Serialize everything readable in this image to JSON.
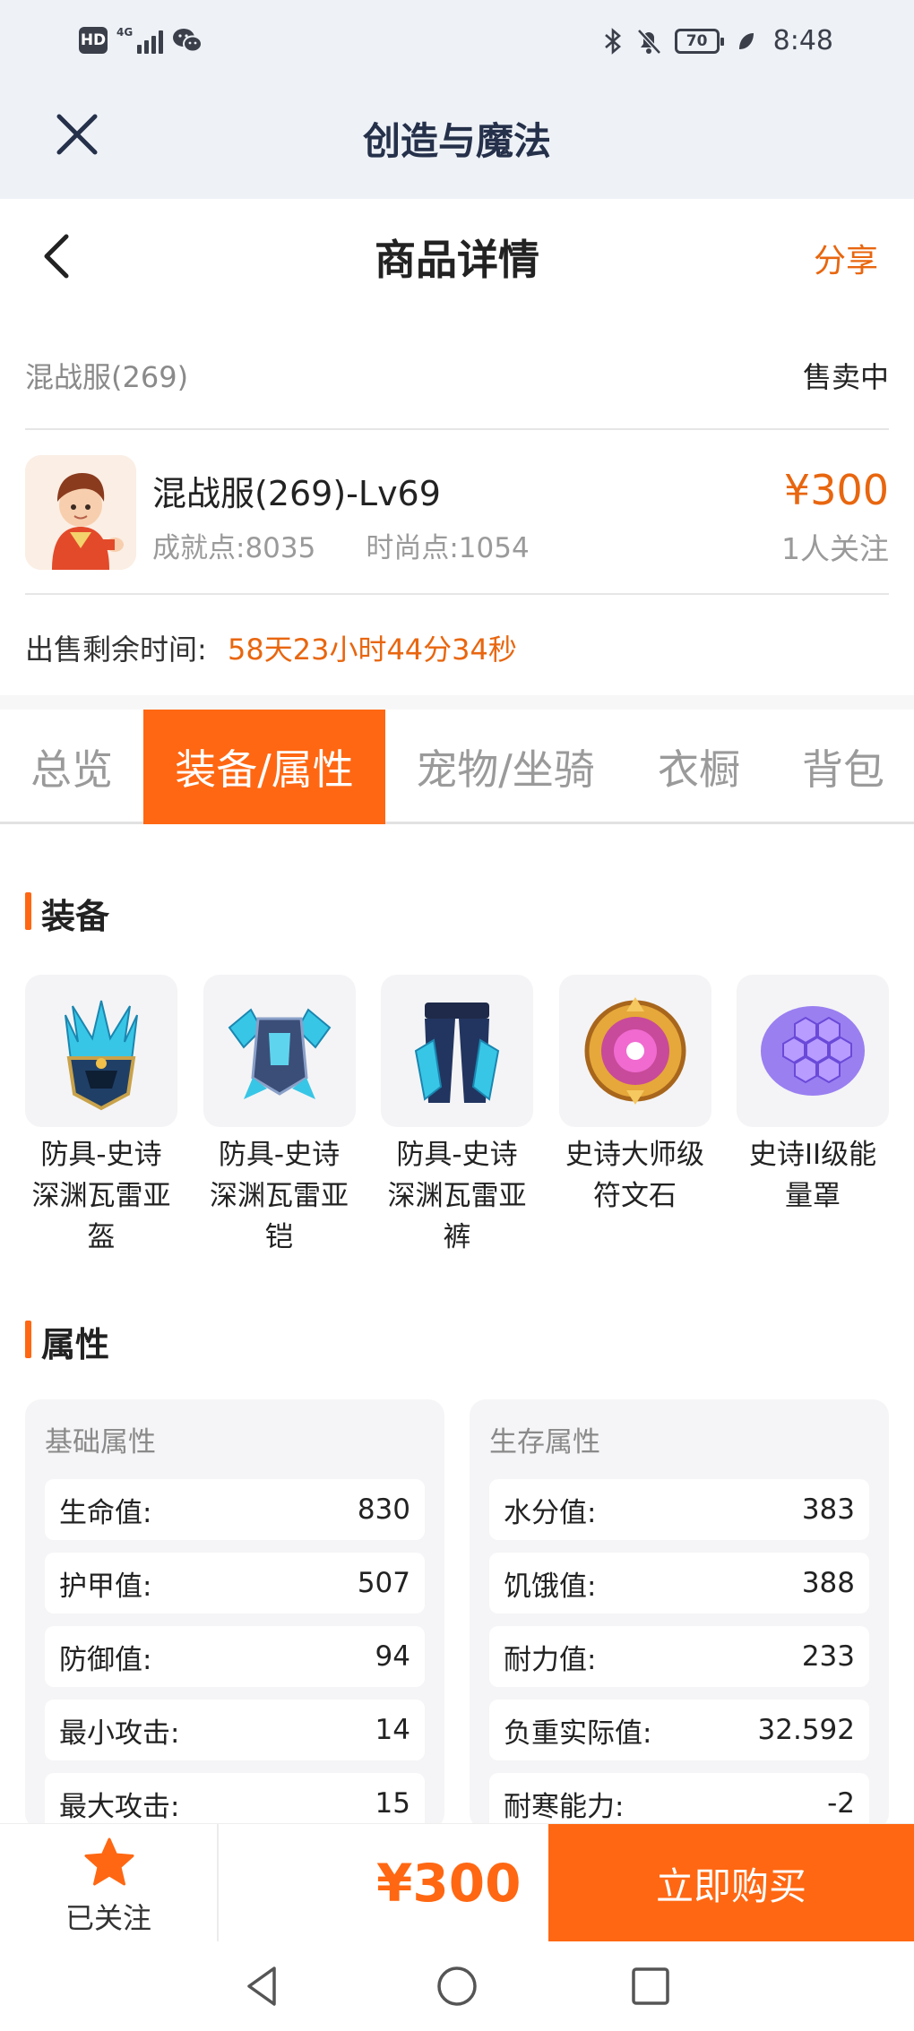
{
  "status_bar": {
    "hd": "HD",
    "network": "4G",
    "battery": "70",
    "time": "8:48"
  },
  "app": {
    "title": "创造与魔法"
  },
  "page": {
    "title": "商品详情",
    "share": "分享"
  },
  "listing": {
    "server": "混战服(269)",
    "status": "售卖中",
    "name": "混战服(269)-Lv69",
    "achievement": "成就点:8035",
    "fashion": "时尚点:1054",
    "price": "¥300",
    "watchers": "1人关注",
    "time_label": "出售剩余时间:",
    "time_value": "58天23小时44分34秒"
  },
  "tabs": [
    {
      "label": "总览"
    },
    {
      "label": "装备/属性"
    },
    {
      "label": "宠物/坐骑"
    },
    {
      "label": "衣橱"
    },
    {
      "label": "背包"
    }
  ],
  "equipment": {
    "title": "装备",
    "items": [
      {
        "line1": "防具-史诗",
        "line2": "深渊瓦雷亚",
        "line3": "盔",
        "icon": "helmet-icon"
      },
      {
        "line1": "防具-史诗",
        "line2": "深渊瓦雷亚",
        "line3": "铠",
        "icon": "armor-icon"
      },
      {
        "line1": "防具-史诗",
        "line2": "深渊瓦雷亚",
        "line3": "裤",
        "icon": "pants-icon"
      },
      {
        "line1": "史诗大师级",
        "line2": "符文石",
        "line3": "",
        "icon": "rune-stone-icon"
      },
      {
        "line1": "史诗II级能",
        "line2": "量罩",
        "line3": "",
        "icon": "energy-shield-icon"
      }
    ]
  },
  "attributes": {
    "title": "属性",
    "basic": {
      "title": "基础属性",
      "rows": [
        {
          "label": "生命值:",
          "value": "830"
        },
        {
          "label": "护甲值:",
          "value": "507"
        },
        {
          "label": "防御值:",
          "value": "94"
        },
        {
          "label": "最小攻击:",
          "value": "14"
        },
        {
          "label": "最大攻击:",
          "value": "15"
        }
      ]
    },
    "survival": {
      "title": "生存属性",
      "rows": [
        {
          "label": "水分值:",
          "value": "383"
        },
        {
          "label": "饥饿值:",
          "value": "388"
        },
        {
          "label": "耐力值:",
          "value": "233"
        },
        {
          "label": "负重实际值:",
          "value": "32.592"
        },
        {
          "label": "耐寒能力:",
          "value": "-2"
        }
      ]
    }
  },
  "bottom": {
    "follow_label": "已关注",
    "price": "¥300",
    "buy_label": "立即购买"
  },
  "colors": {
    "accent": "#ff6712",
    "price": "#e8660f",
    "header_bg": "#eef2f7"
  }
}
